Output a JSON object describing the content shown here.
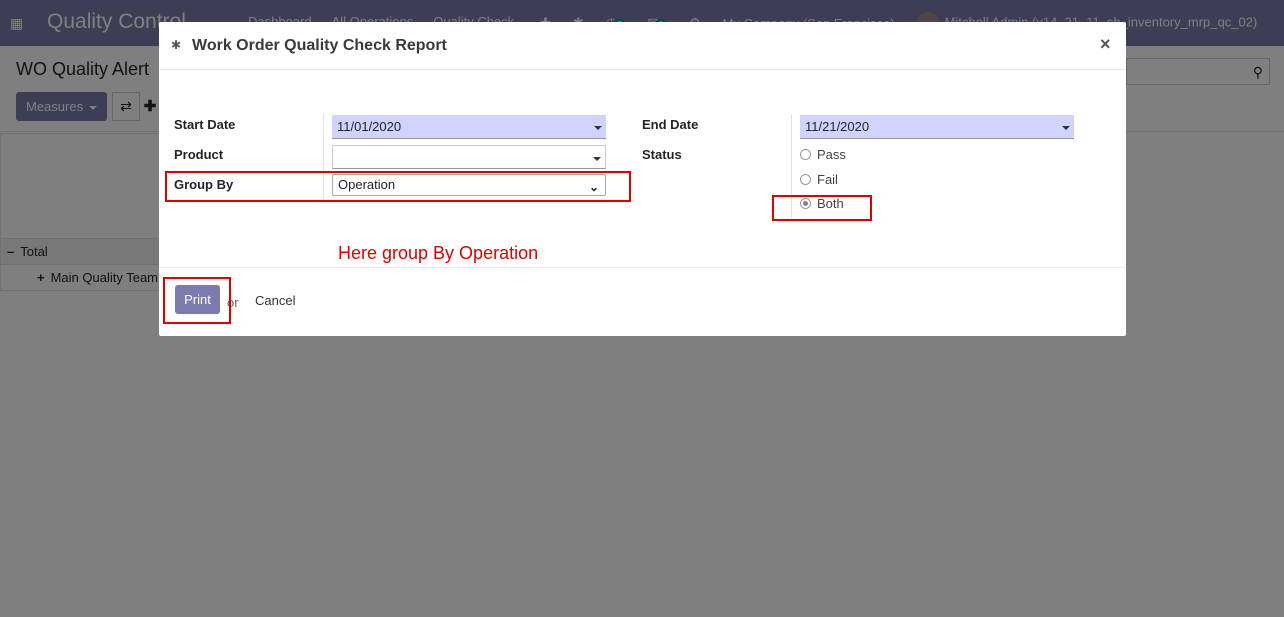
{
  "navbar": {
    "brand": "Quality Control",
    "menu": [
      "Dashboard",
      "All Operations",
      "Quality Check"
    ],
    "badge_activity": "7",
    "badge_messages": "6",
    "company": "My Company (San Francisco)",
    "user": "Mitchell Admin (v14_21_11_sh_inventory_mrp_qc_02)"
  },
  "control_panel": {
    "title": "WO Quality Alert",
    "measures_label": "Measures"
  },
  "pivot": {
    "total_label": "Total",
    "group_label": "Main Quality Team"
  },
  "modal": {
    "title": "Work Order Quality Check Report",
    "start_date_label": "Start Date",
    "start_date_value": "11/01/2020",
    "end_date_label": "End Date",
    "end_date_value": "11/21/2020",
    "product_label": "Product",
    "product_value": "",
    "status_label": "Status",
    "status_options": [
      "Pass",
      "Fail",
      "Both"
    ],
    "status_selected": "Both",
    "group_by_label": "Group By",
    "group_by_value": "Operation",
    "print_label": "Print",
    "or_label": "or",
    "cancel_label": "Cancel"
  },
  "annotation": {
    "text": "Here group By Operation",
    "color": "#e00000"
  },
  "colors": {
    "brand": "#7c7bad",
    "date_field": "#d2d2ff"
  }
}
